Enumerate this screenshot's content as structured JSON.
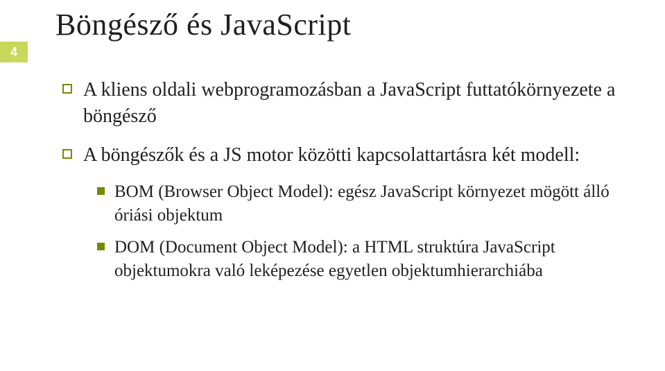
{
  "page_number": "4",
  "title": "Böngésző és JavaScript",
  "bullets": [
    {
      "text": "A kliens oldali webprogramozásban a JavaScript futtatókörnyezete a böngésző",
      "children": []
    },
    {
      "text": "A böngészők és a JS motor közötti kapcsolattartásra két modell:",
      "children": [
        {
          "text": "BOM (Browser Object Model): egész JavaScript környezet mögött álló óriási objektum"
        },
        {
          "text": "DOM (Document Object Model): a HTML struktúra JavaScript objektumokra való leképezése egyetlen objektumhierarchiába"
        }
      ]
    }
  ]
}
